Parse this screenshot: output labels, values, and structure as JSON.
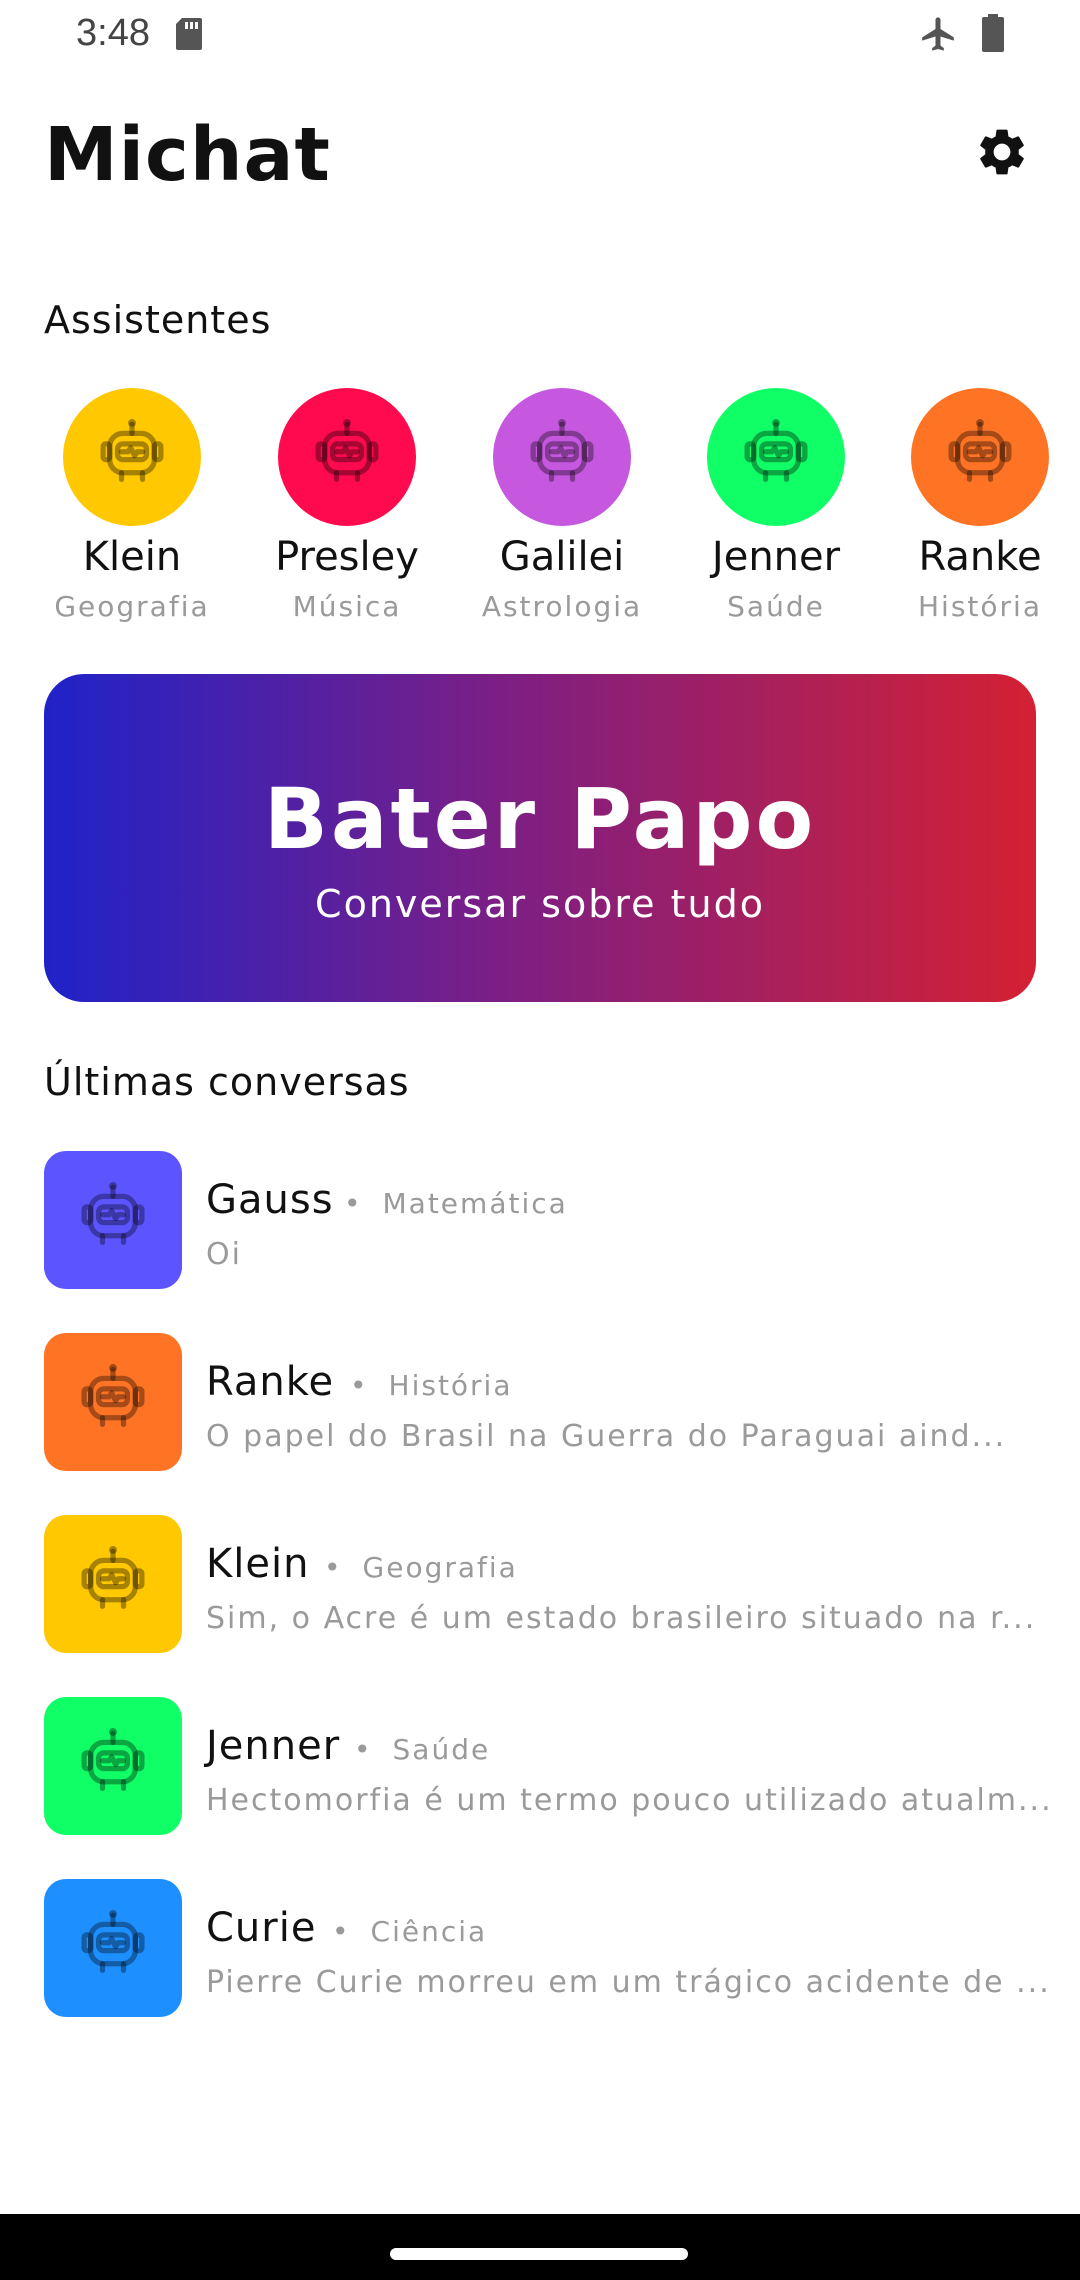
{
  "status_bar": {
    "time": "3:48"
  },
  "header": {
    "title": "Michat"
  },
  "assistants_section": {
    "title": "Assistentes"
  },
  "assistants": [
    {
      "name": "Klein",
      "subject": "Geografia",
      "color": "#FFC800"
    },
    {
      "name": "Presley",
      "subject": "Música",
      "color": "#FF0A4E"
    },
    {
      "name": "Galilei",
      "subject": "Astrologia",
      "color": "#C658E0"
    },
    {
      "name": "Jenner",
      "subject": "Saúde",
      "color": "#10FF66"
    },
    {
      "name": "Ranke",
      "subject": "História",
      "color": "#FF7424"
    }
  ],
  "banner": {
    "title": "Bater Papo",
    "subtitle": "Conversar sobre tudo"
  },
  "recent_section": {
    "title": "Últimas conversas"
  },
  "conversations": [
    {
      "name": "Gauss",
      "subject": "Matemática",
      "preview": "Oi",
      "color": "#5C55FF"
    },
    {
      "name": "Ranke",
      "subject": "História",
      "preview": "O papel do Brasil na Guerra do Paraguai aind...",
      "color": "#FF7424"
    },
    {
      "name": "Klein",
      "subject": "Geografia",
      "preview": "Sim, o Acre é um estado brasileiro situado na r...",
      "color": "#FFC800"
    },
    {
      "name": "Jenner",
      "subject": "Saúde",
      "preview": "Hectomorfia é um termo pouco utilizado atualm...",
      "color": "#10FF66"
    },
    {
      "name": "Curie",
      "subject": "Ciência",
      "preview": "Pierre Curie morreu em um trágico acidente de ...",
      "color": "#1E8FFF"
    }
  ]
}
